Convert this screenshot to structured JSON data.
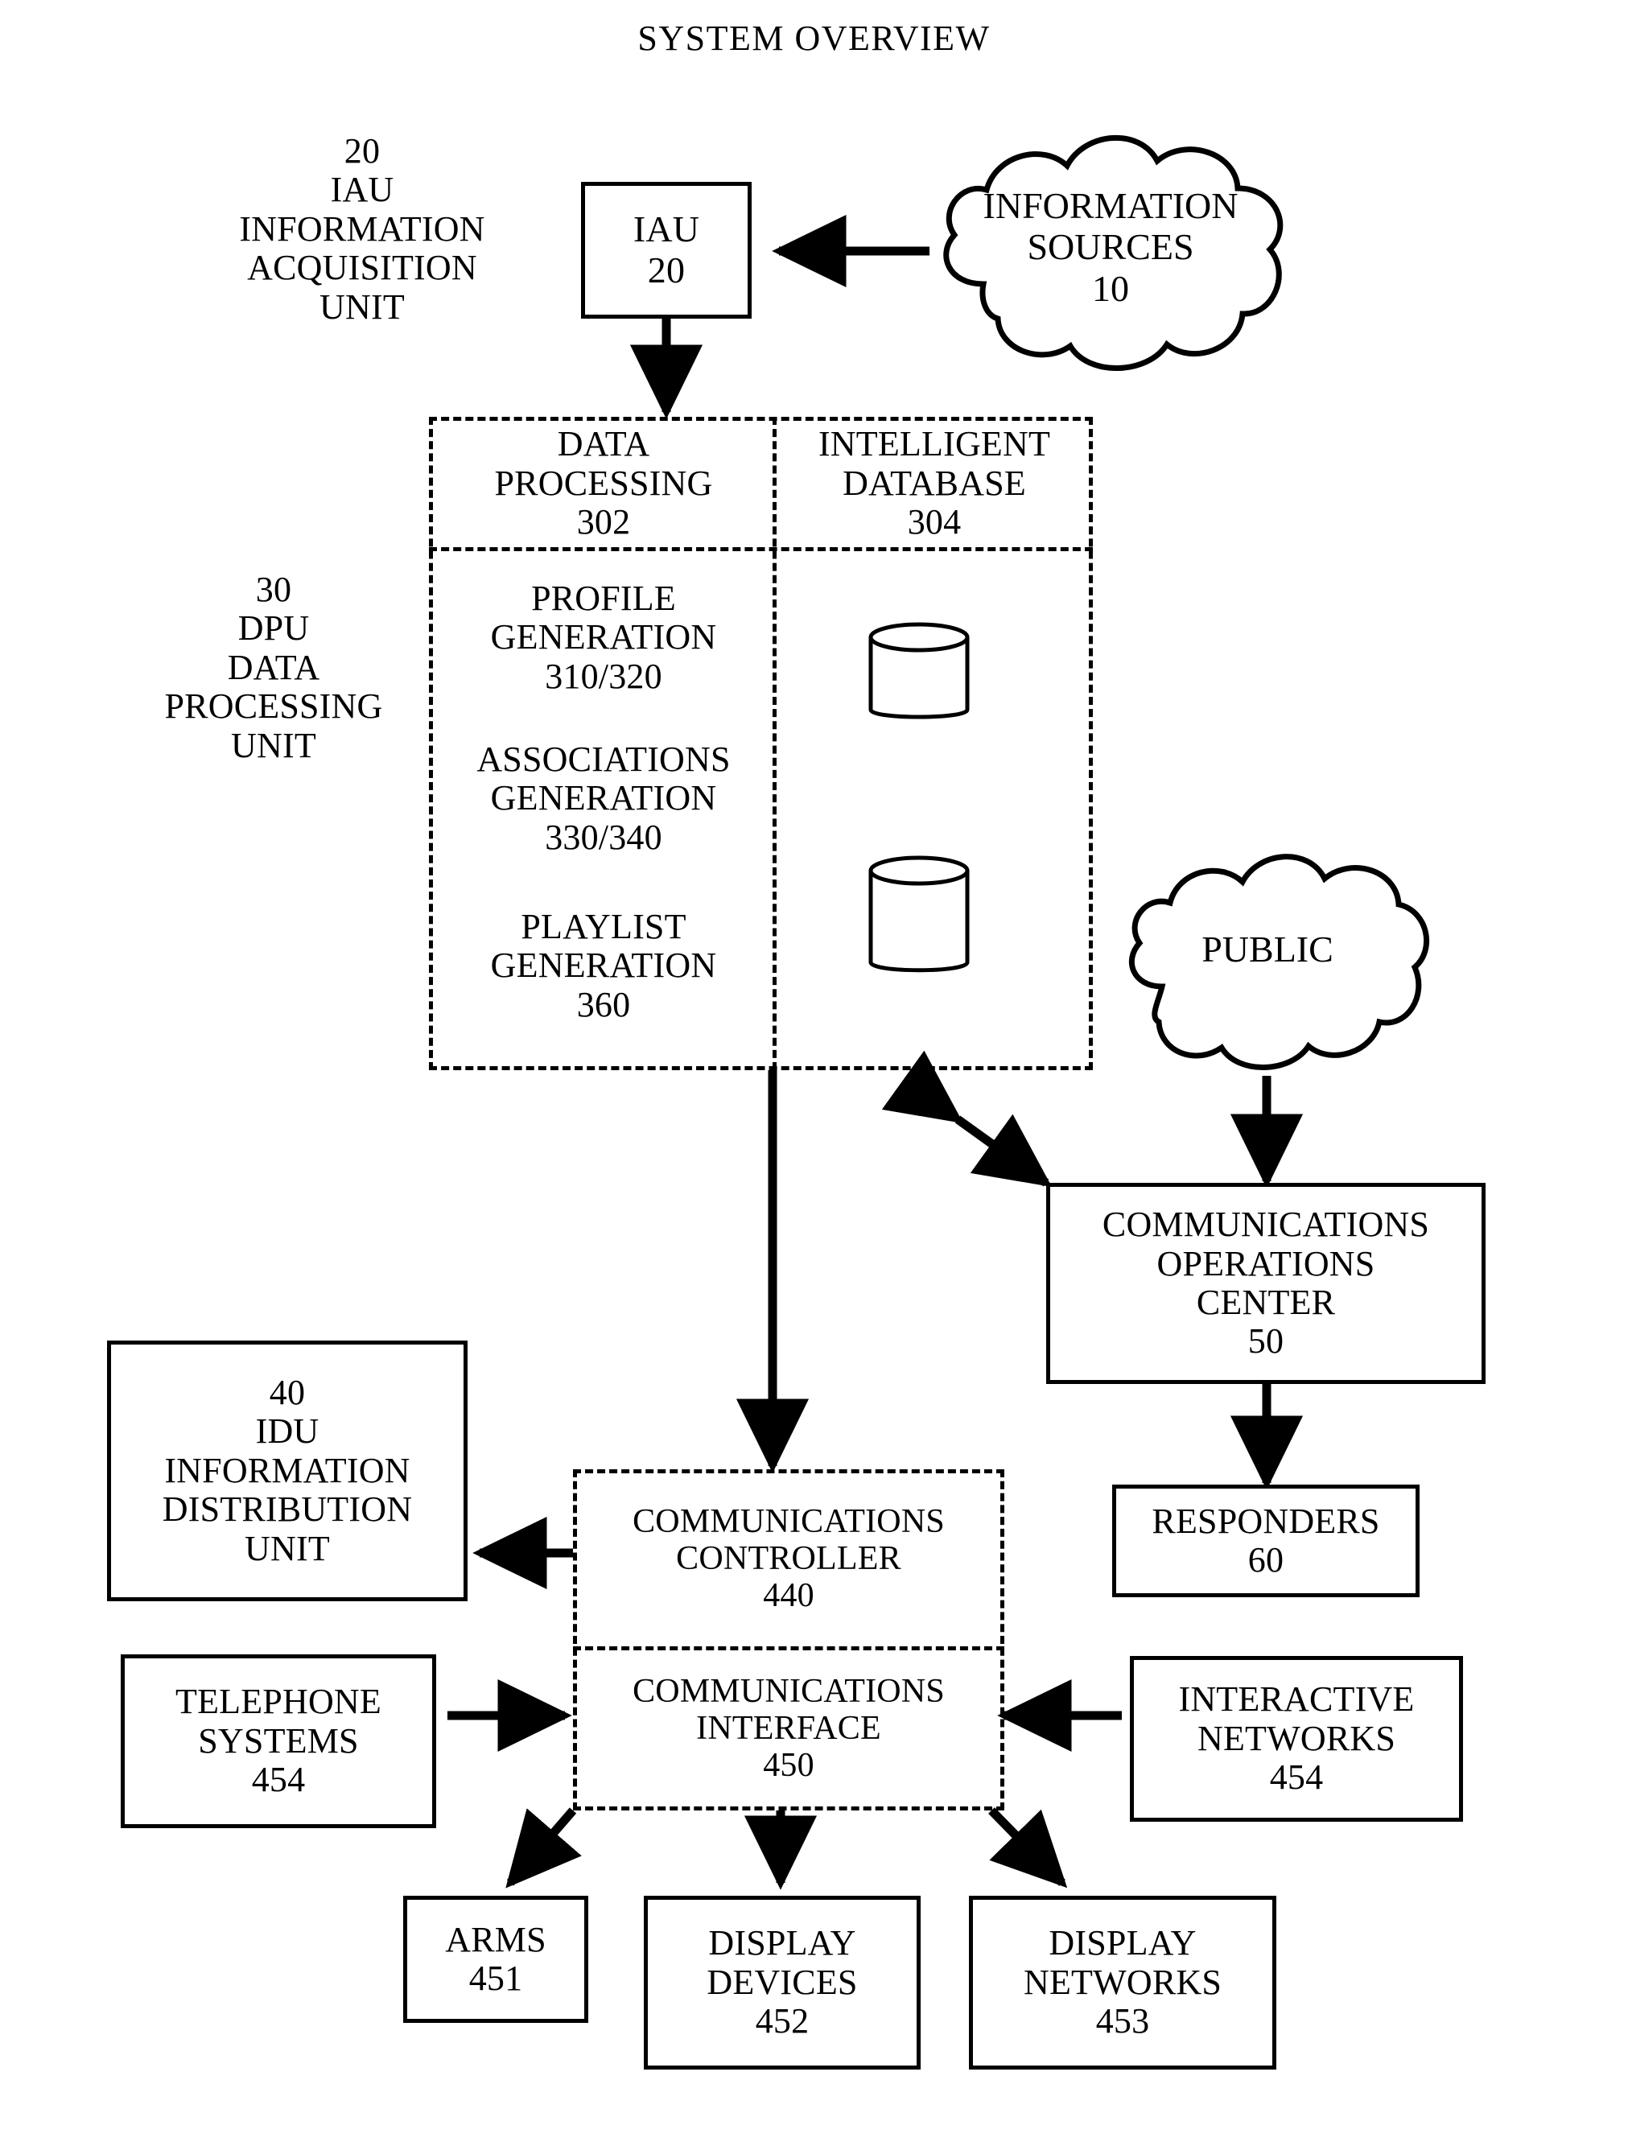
{
  "diagram": {
    "title": "SYSTEM OVERVIEW",
    "type": "block-diagram",
    "colors": {
      "stroke": "#000000",
      "background": "#ffffff"
    }
  },
  "labels": {
    "iau_side": {
      "l1": "20",
      "l2": "IAU",
      "l3": "INFORMATION",
      "l4": "ACQUISITION",
      "l5": "UNIT"
    },
    "dpu_side": {
      "l1": "30",
      "l2": "DPU",
      "l3": "DATA",
      "l4": "PROCESSING",
      "l5": "UNIT"
    }
  },
  "nodes": {
    "iau": {
      "l1": "IAU",
      "l2": "20",
      "shape": "solid-box"
    },
    "information_sources": {
      "l1": "INFORMATION",
      "l2": "SOURCES",
      "l3": "10",
      "shape": "cloud"
    },
    "data_processing": {
      "l1": "DATA",
      "l2": "PROCESSING",
      "l3": "302",
      "shape": "dashed-cell"
    },
    "intelligent_database": {
      "l1": "INTELLIGENT",
      "l2": "DATABASE",
      "l3": "304",
      "shape": "dashed-cell"
    },
    "profile_generation": {
      "l1": "PROFILE",
      "l2": "GENERATION",
      "l3": "310/320",
      "shape": "dashed-cell"
    },
    "associations_generation": {
      "l1": "ASSOCIATIONS",
      "l2": "GENERATION",
      "l3": "330/340",
      "shape": "dashed-cell"
    },
    "playlist_generation": {
      "l1": "PLAYLIST",
      "l2": "GENERATION",
      "l3": "360",
      "shape": "dashed-cell"
    },
    "public": {
      "l1": "PUBLIC",
      "shape": "cloud"
    },
    "communications_operations_center": {
      "l1": "COMMUNICATIONS",
      "l2": "OPERATIONS",
      "l3": "CENTER",
      "l4": "50",
      "shape": "solid-box"
    },
    "responders": {
      "l1": "RESPONDERS",
      "l2": "60",
      "shape": "solid-box"
    },
    "idu": {
      "l1": "40",
      "l2": "IDU",
      "l3": "INFORMATION",
      "l4": "DISTRIBUTION",
      "l5": "UNIT",
      "shape": "solid-box"
    },
    "communications_controller": {
      "l1": "COMMUNICATIONS",
      "l2": "CONTROLLER",
      "l3": "440",
      "shape": "dashed-cell"
    },
    "communications_interface": {
      "l1": "COMMUNICATIONS",
      "l2": "INTERFACE",
      "l3": "450",
      "shape": "dashed-cell"
    },
    "telephone_systems": {
      "l1": "TELEPHONE",
      "l2": "SYSTEMS",
      "l3": "454",
      "shape": "solid-box"
    },
    "interactive_networks": {
      "l1": "INTERACTIVE",
      "l2": "NETWORKS",
      "l3": "454",
      "shape": "solid-box"
    },
    "arms": {
      "l1": "ARMS",
      "l2": "451",
      "shape": "solid-box"
    },
    "display_devices": {
      "l1": "DISPLAY",
      "l2": "DEVICES",
      "l3": "452",
      "shape": "solid-box"
    },
    "display_networks": {
      "l1": "DISPLAY",
      "l2": "NETWORKS",
      "l3": "453",
      "shape": "solid-box"
    }
  },
  "connections": [
    {
      "from": "information_sources",
      "to": "iau",
      "style": "arrow-left"
    },
    {
      "from": "iau",
      "to": "data_processing",
      "style": "arrow-down"
    },
    {
      "from": "data_processing_unit",
      "to": "communications_operations_center",
      "style": "arrow-both"
    },
    {
      "from": "public",
      "to": "communications_operations_center",
      "style": "arrow-down"
    },
    {
      "from": "communications_operations_center",
      "to": "responders",
      "style": "arrow-down"
    },
    {
      "from": "data_processing_unit",
      "to": "communications_controller",
      "style": "arrow-down"
    },
    {
      "from": "communications_controller",
      "to": "idu",
      "style": "arrow-left"
    },
    {
      "from": "telephone_systems",
      "to": "communications_interface",
      "style": "arrow-right"
    },
    {
      "from": "interactive_networks",
      "to": "communications_interface",
      "style": "arrow-left"
    },
    {
      "from": "communications_interface",
      "to": "arms",
      "style": "arrow-down-left"
    },
    {
      "from": "communications_interface",
      "to": "display_devices",
      "style": "arrow-down"
    },
    {
      "from": "communications_interface",
      "to": "display_networks",
      "style": "arrow-down-right"
    }
  ]
}
